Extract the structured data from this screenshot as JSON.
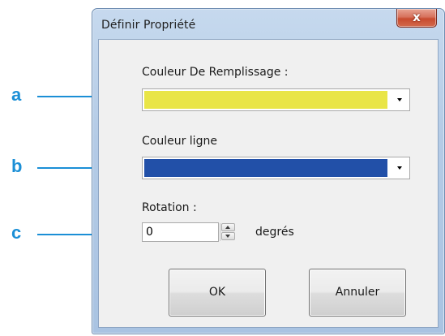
{
  "window": {
    "title": "Définir Propriété",
    "close_glyph": "x"
  },
  "fill_color": {
    "label": "Couleur De Remplissage :",
    "swatch_color": "#e9e547"
  },
  "line_color": {
    "label": "Couleur ligne",
    "swatch_color": "#2250a8"
  },
  "rotation": {
    "label": "Rotation :",
    "value": "0",
    "unit": "degrés"
  },
  "buttons": {
    "ok": "OK",
    "cancel": "Annuler"
  },
  "callouts": {
    "a": "a",
    "b": "b",
    "c": "c",
    "color": "#1b8fd6"
  }
}
